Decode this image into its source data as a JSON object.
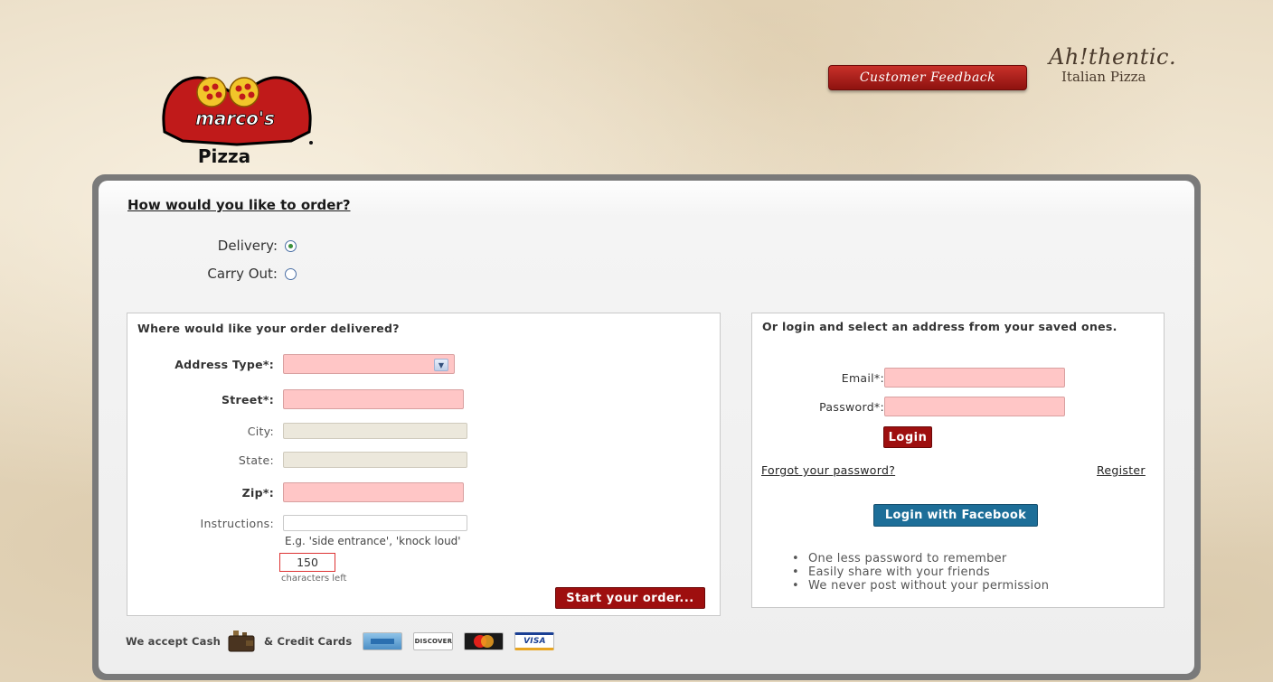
{
  "brand": {
    "logo_top_text": "marco's",
    "logo_bottom_text": "Pizza",
    "tagline_line1": "Ah!thentic.",
    "tagline_line2": "Italian Pizza"
  },
  "header": {
    "feedback_label": "Customer Feedback"
  },
  "order_type": {
    "heading": "How would you like to order?",
    "options": [
      {
        "label": "Delivery:",
        "checked": true
      },
      {
        "label": "Carry Out:",
        "checked": false
      }
    ]
  },
  "delivery_form": {
    "title": "Where would like your order delivered?",
    "fields": {
      "address_type": "Address Type*:",
      "street": "Street*:",
      "city": "City:",
      "state": "State:",
      "zip": "Zip*:",
      "instructions": "Instructions:"
    },
    "instructions_hint": "E.g. 'side entrance', 'knock loud'",
    "chars_left_value": "150",
    "chars_left_label": "characters left",
    "submit_label": "Start your order..."
  },
  "login_form": {
    "title": "Or login and select an address from your saved ones.",
    "email_label": "Email*:",
    "password_label": "Password*:",
    "login_label": "Login",
    "forgot_label": "Forgot your password?",
    "register_label": "Register",
    "facebook_label": "Login with Facebook",
    "benefits": [
      "One less password to remember",
      "Easily share with your friends",
      "We never post without your permission"
    ]
  },
  "payment": {
    "cash_text": "We accept Cash",
    "cards_text": "& Credit Cards",
    "cards": [
      "amex-card-icon",
      "discover-card-icon",
      "mastercard-card-icon",
      "visa-card-icon"
    ],
    "discover_text": "DISCOVER",
    "visa_text": "VISA"
  },
  "colors": {
    "brand_red": "#9e0f0f",
    "required_field": "#ffc6c6",
    "facebook_blue": "#1d6e98"
  }
}
